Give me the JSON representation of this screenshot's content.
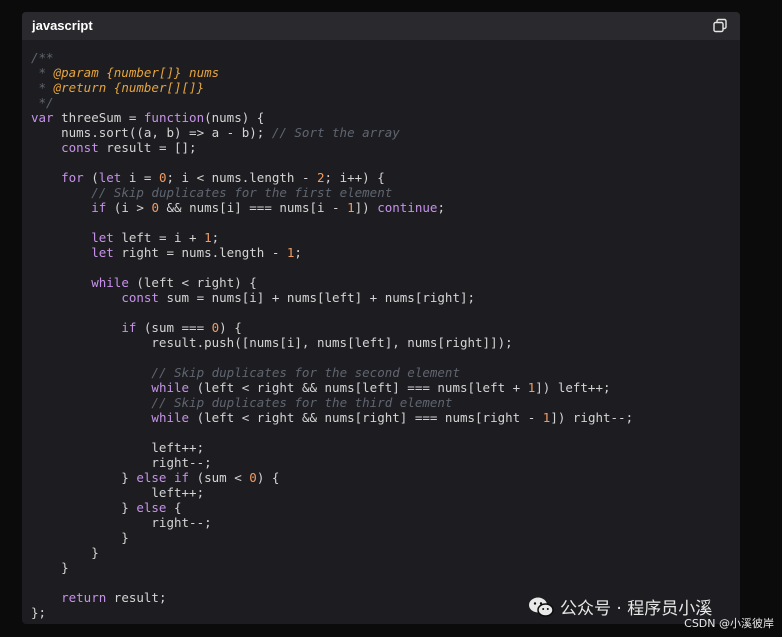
{
  "code_block": {
    "language": "javascript",
    "copy_icon": "copy-icon",
    "lines": [
      [
        {
          "t": "/**",
          "c": "cm"
        }
      ],
      [
        {
          "t": " * ",
          "c": "cm"
        },
        {
          "t": "@param",
          "c": "tag"
        },
        {
          "t": " {number[]} nums",
          "c": "tag"
        }
      ],
      [
        {
          "t": " * ",
          "c": "cm"
        },
        {
          "t": "@return",
          "c": "tag"
        },
        {
          "t": " {number[][]}",
          "c": "tag"
        }
      ],
      [
        {
          "t": " */",
          "c": "cm"
        }
      ],
      [
        {
          "t": "var",
          "c": "kw"
        },
        {
          "t": " threeSum = ",
          "c": "id"
        },
        {
          "t": "function",
          "c": "kw"
        },
        {
          "t": "(nums) {",
          "c": "id"
        }
      ],
      [
        {
          "t": "    nums.sort((a, b) => a - b); ",
          "c": "id"
        },
        {
          "t": "// Sort the array",
          "c": "cm"
        }
      ],
      [
        {
          "t": "    ",
          "c": "id"
        },
        {
          "t": "const",
          "c": "kw"
        },
        {
          "t": " result = [];",
          "c": "id"
        }
      ],
      [],
      [
        {
          "t": "    ",
          "c": "id"
        },
        {
          "t": "for",
          "c": "kw"
        },
        {
          "t": " (",
          "c": "id"
        },
        {
          "t": "let",
          "c": "kw"
        },
        {
          "t": " i = ",
          "c": "id"
        },
        {
          "t": "0",
          "c": "num"
        },
        {
          "t": "; i < nums.length - ",
          "c": "id"
        },
        {
          "t": "2",
          "c": "num"
        },
        {
          "t": "; i++) {",
          "c": "id"
        }
      ],
      [
        {
          "t": "        ",
          "c": "id"
        },
        {
          "t": "// Skip duplicates for the first element",
          "c": "cm"
        }
      ],
      [
        {
          "t": "        ",
          "c": "id"
        },
        {
          "t": "if",
          "c": "kw"
        },
        {
          "t": " (i > ",
          "c": "id"
        },
        {
          "t": "0",
          "c": "num"
        },
        {
          "t": " && nums[i] === nums[i - ",
          "c": "id"
        },
        {
          "t": "1",
          "c": "num"
        },
        {
          "t": "]) ",
          "c": "id"
        },
        {
          "t": "continue",
          "c": "kw"
        },
        {
          "t": ";",
          "c": "id"
        }
      ],
      [],
      [
        {
          "t": "        ",
          "c": "id"
        },
        {
          "t": "let",
          "c": "kw"
        },
        {
          "t": " left = i + ",
          "c": "id"
        },
        {
          "t": "1",
          "c": "num"
        },
        {
          "t": ";",
          "c": "id"
        }
      ],
      [
        {
          "t": "        ",
          "c": "id"
        },
        {
          "t": "let",
          "c": "kw"
        },
        {
          "t": " right = nums.length - ",
          "c": "id"
        },
        {
          "t": "1",
          "c": "num"
        },
        {
          "t": ";",
          "c": "id"
        }
      ],
      [],
      [
        {
          "t": "        ",
          "c": "id"
        },
        {
          "t": "while",
          "c": "kw"
        },
        {
          "t": " (left < right) {",
          "c": "id"
        }
      ],
      [
        {
          "t": "            ",
          "c": "id"
        },
        {
          "t": "const",
          "c": "kw"
        },
        {
          "t": " sum = nums[i] + nums[left] + nums[right];",
          "c": "id"
        }
      ],
      [],
      [
        {
          "t": "            ",
          "c": "id"
        },
        {
          "t": "if",
          "c": "kw"
        },
        {
          "t": " (sum === ",
          "c": "id"
        },
        {
          "t": "0",
          "c": "num"
        },
        {
          "t": ") {",
          "c": "id"
        }
      ],
      [
        {
          "t": "                result.push([nums[i], nums[left], nums[right]]);",
          "c": "id"
        }
      ],
      [],
      [
        {
          "t": "                ",
          "c": "id"
        },
        {
          "t": "// Skip duplicates for the second element",
          "c": "cm"
        }
      ],
      [
        {
          "t": "                ",
          "c": "id"
        },
        {
          "t": "while",
          "c": "kw"
        },
        {
          "t": " (left < right && nums[left] === nums[left + ",
          "c": "id"
        },
        {
          "t": "1",
          "c": "num"
        },
        {
          "t": "]) left++;",
          "c": "id"
        }
      ],
      [
        {
          "t": "                ",
          "c": "id"
        },
        {
          "t": "// Skip duplicates for the third element",
          "c": "cm"
        }
      ],
      [
        {
          "t": "                ",
          "c": "id"
        },
        {
          "t": "while",
          "c": "kw"
        },
        {
          "t": " (left < right && nums[right] === nums[right - ",
          "c": "id"
        },
        {
          "t": "1",
          "c": "num"
        },
        {
          "t": "]) right--;",
          "c": "id"
        }
      ],
      [],
      [
        {
          "t": "                left++;",
          "c": "id"
        }
      ],
      [
        {
          "t": "                right--;",
          "c": "id"
        }
      ],
      [
        {
          "t": "            } ",
          "c": "id"
        },
        {
          "t": "else",
          "c": "kw"
        },
        {
          "t": " ",
          "c": "id"
        },
        {
          "t": "if",
          "c": "kw"
        },
        {
          "t": " (sum < ",
          "c": "id"
        },
        {
          "t": "0",
          "c": "num"
        },
        {
          "t": ") {",
          "c": "id"
        }
      ],
      [
        {
          "t": "                left++;",
          "c": "id"
        }
      ],
      [
        {
          "t": "            } ",
          "c": "id"
        },
        {
          "t": "else",
          "c": "kw"
        },
        {
          "t": " {",
          "c": "id"
        }
      ],
      [
        {
          "t": "                right--;",
          "c": "id"
        }
      ],
      [
        {
          "t": "            }",
          "c": "id"
        }
      ],
      [
        {
          "t": "        }",
          "c": "id"
        }
      ],
      [
        {
          "t": "    }",
          "c": "id"
        }
      ],
      [],
      [
        {
          "t": "    ",
          "c": "id"
        },
        {
          "t": "return",
          "c": "kw"
        },
        {
          "t": " result;",
          "c": "id"
        }
      ],
      [
        {
          "t": "};",
          "c": "id"
        }
      ]
    ]
  },
  "watermark": {
    "icon": "wechat-icon",
    "text": "公众号 · 程序员小溪",
    "csdn": "CSDN @小溪彼岸"
  },
  "colors": {
    "background": "#0b0b0c",
    "code_bg": "#1d1d21",
    "header_bg": "#2a2a2e",
    "keyword": "#c792ea",
    "number": "#f29b62",
    "comment": "#5f6570",
    "jsdoc_tag": "#e6a43c",
    "text": "#d4d4d4"
  }
}
